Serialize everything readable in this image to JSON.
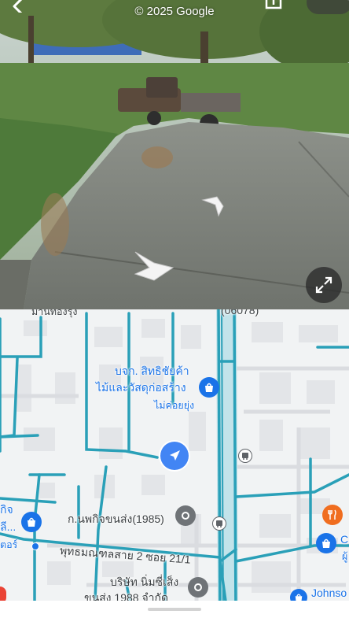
{
  "street_view": {
    "copyright": "© 2025 Google",
    "icons": {
      "back": "back-arrow-icon",
      "share": "share-icon",
      "expand": "expand-icon",
      "nav_forward": "chevron-nav-icon",
      "nav_side": "chevron-nav-icon"
    }
  },
  "map": {
    "labels": {
      "top_code": "(06078)",
      "top_place": "ม้านทองรุ่ง",
      "store_line1": "บจก. สิทธิชัยค้า",
      "store_line2": "ไม้และวัสดุก่อสร้าง",
      "store_sub": "ไม่ค่อยยุ่ง",
      "transport": "ก.นพกิจขนส่ง(1985)",
      "left_place_1": "กิจ",
      "left_place_2": "ลี...",
      "left_place_3": "ตอร์",
      "road": "พุทธมณฑลสาย 2 ซอย 21/1",
      "company_line1": "บริษัท นิ่มซี่เส็ง",
      "company_line2": "ขนส่ง 1988 จำกัด",
      "right_place_1": "C",
      "right_place_2": "ผู้",
      "johnson": "Johnso"
    },
    "colors": {
      "road": "#2aa0b8",
      "shop_pin": "#1a73e8",
      "food_pin": "#f06d1f",
      "place_pin": "#5f6368",
      "location": "#4285f4",
      "red_marker": "#ea4335"
    }
  }
}
